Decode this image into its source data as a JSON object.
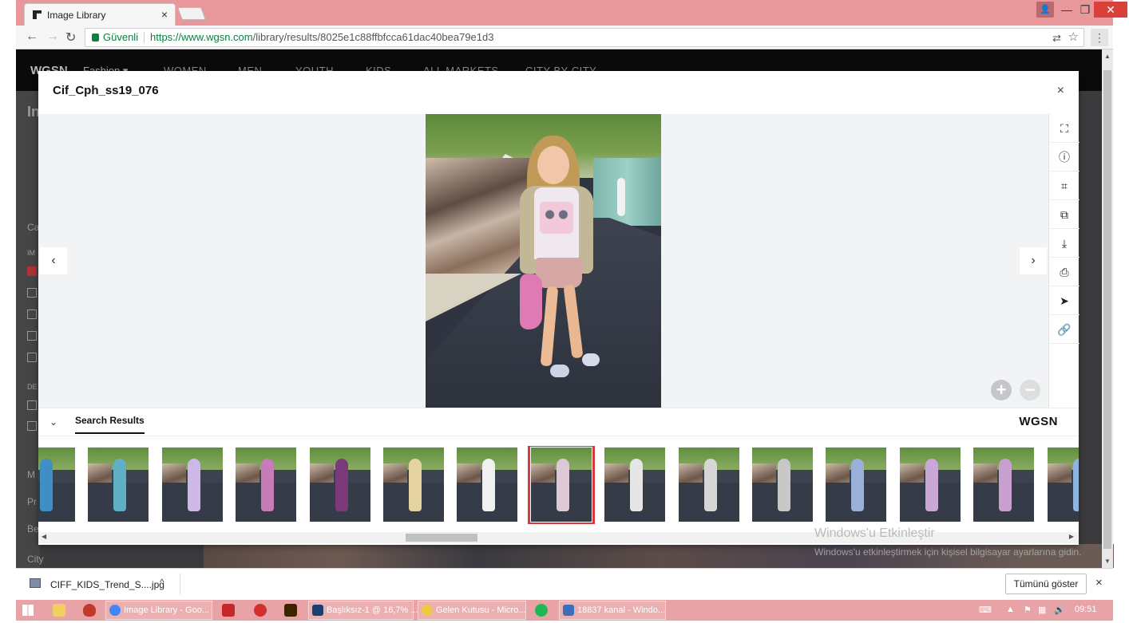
{
  "browser": {
    "tab_title": "Image Library",
    "tab_close": "×",
    "secure_label": "Güvenli",
    "url_base": "https://www.wgsn.com",
    "url_path": "/library/results/8025e1c88ffbfcca61dac40bea79e1d3",
    "menu_icon": "⋮"
  },
  "site_nav": {
    "logo": "WGSN",
    "section": "Fashion ▾",
    "items": [
      "WOMEN",
      "MEN",
      "YOUTH",
      "KIDS",
      "ALL MARKETS",
      "CITY BY CITY"
    ]
  },
  "sidebar_bg": {
    "labels": [
      "In",
      "Ca",
      "IM",
      "DE",
      "M",
      "Pr",
      "Be",
      "City"
    ]
  },
  "modal": {
    "title": "Cif_Cph_ss19_076",
    "close": "×",
    "prev": "‹",
    "next": "›",
    "zoom_in": "+",
    "zoom_out": "−",
    "tools": [
      {
        "icon": "fullscreen-icon",
        "glyph": "⛶"
      },
      {
        "icon": "info-icon",
        "glyph": "ⓘ"
      },
      {
        "icon": "crop-icon",
        "glyph": "⌗"
      },
      {
        "icon": "add-to-board-icon",
        "glyph": "⧉"
      },
      {
        "icon": "download-icon",
        "glyph": "⤓"
      },
      {
        "icon": "print-icon",
        "glyph": "⎙"
      },
      {
        "icon": "send-icon",
        "glyph": "➤"
      },
      {
        "icon": "link-icon",
        "glyph": "🔗"
      }
    ],
    "results_tab": "Search Results",
    "collapse": "⌄",
    "brand": "WGSN",
    "thumbnails_count": 15,
    "selected_index": 7
  },
  "watermark": {
    "title": "Windows'u Etkinleştir",
    "subtitle": "Windows'u etkinleştirmek için kişisel bilgisayar ayarlarına gidin."
  },
  "download_shelf": {
    "file_name": "CIFF_KIDS_Trend_S....jpg",
    "caret": "^",
    "show_all": "Tümünü göster",
    "close": "×"
  },
  "taskbar": {
    "apps": [
      {
        "label": "Image Library - Goo...",
        "color": "#4285f4"
      },
      {
        "label": "Başlıksız-1 @ 16,7% ...",
        "color": "#1b3f72"
      },
      {
        "label": "Gelen Kutusu - Micro...",
        "color": "#f2c744"
      },
      {
        "label": "18837 kanal - Windo...",
        "color": "#3c6fb8"
      }
    ],
    "time": "09:51"
  }
}
